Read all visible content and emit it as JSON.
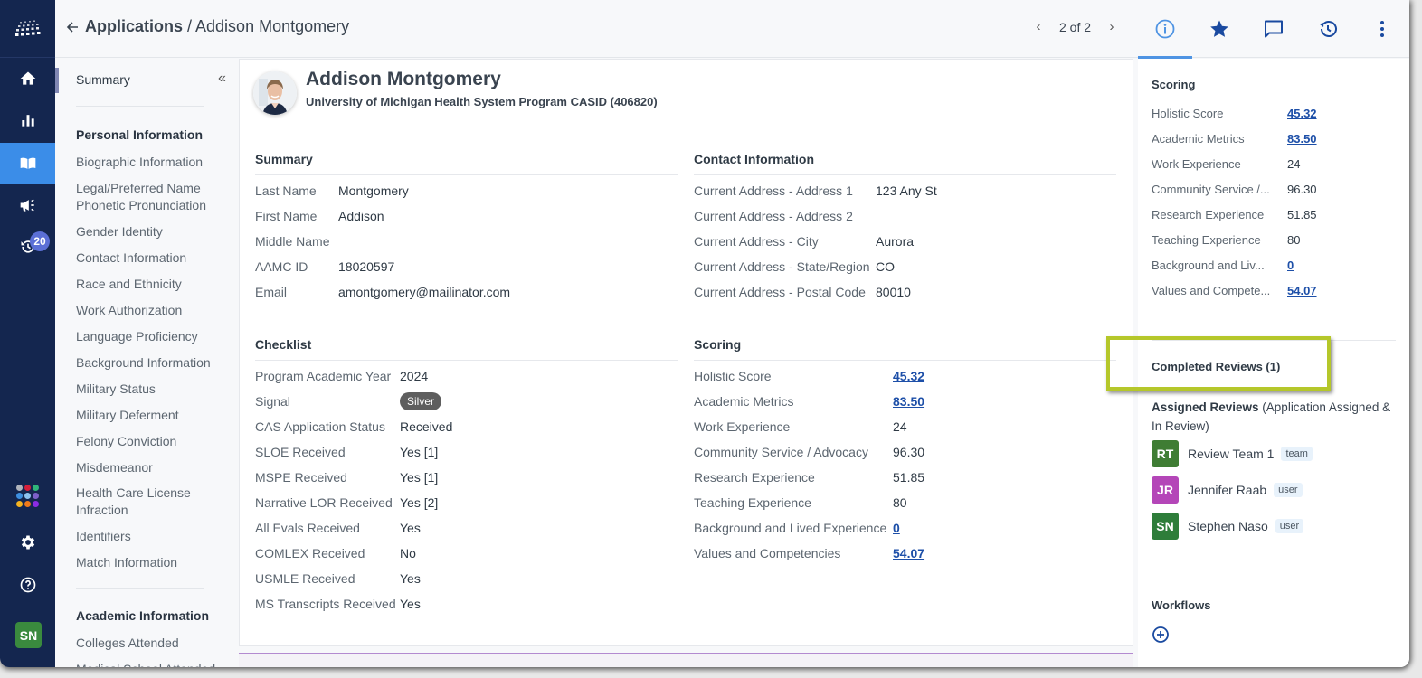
{
  "header": {
    "breadcrumb_root": "Applications",
    "breadcrumb_sep": " / ",
    "breadcrumb_current": "Addison Montgomery",
    "pager": "2 of 2",
    "tabs": [
      {
        "name": "info",
        "icon": "info-icon",
        "active": true
      },
      {
        "name": "favorite",
        "icon": "star-icon",
        "active": false
      },
      {
        "name": "comments",
        "icon": "comment-icon",
        "active": false
      },
      {
        "name": "history",
        "icon": "history-icon",
        "active": false
      },
      {
        "name": "more",
        "icon": "more-vertical-icon",
        "active": false
      }
    ]
  },
  "rail": {
    "items": [
      "home",
      "reports",
      "applications",
      "announcements",
      "history"
    ],
    "history_badge": "20",
    "user_initials": "SN",
    "app_grid_colors": [
      "#b0b4bc",
      "#d61f3a",
      "#2fb57a",
      "#3d8fe0",
      "#8ec3ef",
      "#7c5fc9",
      "#f5b320",
      "#f07a1a",
      "#8b2be2"
    ]
  },
  "nav": {
    "summary": "Summary",
    "collapse": "«",
    "personal_title": "Personal Information",
    "personal_links": [
      "Biographic Information",
      "Legal/Preferred Name Phonetic Pronunciation",
      "Gender Identity",
      "Contact Information",
      "Race and Ethnicity",
      "Work Authorization",
      "Language Proficiency",
      "Background Information",
      "Military Status",
      "Military Deferment",
      "Felony Conviction",
      "Misdemeanor",
      "Health Care License Infraction",
      "Identifiers",
      "Match Information"
    ],
    "academic_title": "Academic Information",
    "academic_links": [
      "Colleges Attended",
      "Medical School Attended"
    ]
  },
  "profile": {
    "name": "Addison Montgomery",
    "program": "University of Michigan Health System Program CASID (406820)"
  },
  "summary": {
    "title": "Summary",
    "rows": [
      {
        "k": "Last Name",
        "v": "Montgomery"
      },
      {
        "k": "First Name",
        "v": "Addison"
      },
      {
        "k": "Middle Name",
        "v": ""
      },
      {
        "k": "AAMC ID",
        "v": "18020597"
      },
      {
        "k": "Email",
        "v": "amontgomery@mailinator.com"
      }
    ]
  },
  "contact": {
    "title": "Contact Information",
    "rows": [
      {
        "k": "Current Address - Address 1",
        "v": "123 Any St"
      },
      {
        "k": "Current Address - Address 2",
        "v": ""
      },
      {
        "k": "Current Address - City",
        "v": "Aurora"
      },
      {
        "k": "Current Address - State/Region",
        "v": "CO"
      },
      {
        "k": "Current Address - Postal Code",
        "v": "80010"
      }
    ]
  },
  "checklist": {
    "title": "Checklist",
    "rows": [
      {
        "k": "Program Academic Year",
        "v": "2024"
      },
      {
        "k": "Signal",
        "v": "Silver",
        "pill": true
      },
      {
        "k": "CAS Application Status",
        "v": "Received"
      },
      {
        "k": "SLOE Received",
        "v": "Yes [1]"
      },
      {
        "k": "MSPE Received",
        "v": "Yes [1]"
      },
      {
        "k": "Narrative LOR Received",
        "v": "Yes [2]"
      },
      {
        "k": "All Evals Received",
        "v": "Yes"
      },
      {
        "k": "COMLEX Received",
        "v": "No"
      },
      {
        "k": "USMLE Received",
        "v": "Yes"
      },
      {
        "k": "MS Transcripts Received",
        "v": "Yes"
      }
    ]
  },
  "scoring": {
    "title": "Scoring",
    "rows": [
      {
        "k": "Holistic Score",
        "short": "Holistic Score",
        "v": "45.32",
        "link": true
      },
      {
        "k": "Academic Metrics",
        "short": "Academic Metrics",
        "v": "83.50",
        "link": true
      },
      {
        "k": "Work Experience",
        "short": "Work Experience",
        "v": "24",
        "link": false
      },
      {
        "k": "Community Service / Advocacy",
        "short": "Community Service /...",
        "v": "96.30",
        "link": false
      },
      {
        "k": "Research Experience",
        "short": "Research Experience",
        "v": "51.85",
        "link": false
      },
      {
        "k": "Teaching Experience",
        "short": "Teaching Experience",
        "v": "80",
        "link": false
      },
      {
        "k": "Background and Lived Experience",
        "short": "Background and Liv...",
        "v": "0",
        "link": true
      },
      {
        "k": "Values and Competencies",
        "short": "Values and Compete...",
        "v": "54.07",
        "link": true
      }
    ]
  },
  "right": {
    "scoring_title": "Scoring",
    "completed_reviews": "Completed Reviews (1)",
    "assigned_title": "Assigned Reviews",
    "assigned_note": " (Application Assigned & In Review)",
    "reviewers": [
      {
        "initials": "RT",
        "name": "Review Team 1",
        "tag": "team",
        "color": "#3f7d34"
      },
      {
        "initials": "JR",
        "name": "Jennifer Raab",
        "tag": "user",
        "color": "#b446b8"
      },
      {
        "initials": "SN",
        "name": "Stephen Naso",
        "tag": "user",
        "color": "#2e7d3a"
      }
    ],
    "workflows_title": "Workflows"
  },
  "colors": {
    "rail_bg": "#14264f",
    "rail_active": "#3b8de8",
    "link": "#1d4fa8",
    "highlight": "#b5c72a"
  }
}
